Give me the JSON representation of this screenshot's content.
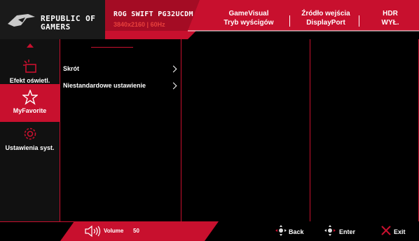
{
  "header": {
    "brand_line1": "REPUBLIC OF",
    "brand_line2": "GAMERS",
    "model": "ROG SWIFT PG32UCDM",
    "resolution": "3840x2160 |",
    "refresh": "60Hz",
    "status": [
      {
        "title": "GameVisual",
        "value": "Tryb wyścigów"
      },
      {
        "title": "Źródło wejścia",
        "value": "DisplayPort"
      },
      {
        "title": "HDR",
        "value": "WYŁ."
      }
    ]
  },
  "sidebar": {
    "items": [
      {
        "label": "Efekt oświetl.",
        "icon": "light-effect-icon"
      },
      {
        "label": "MyFavorite",
        "icon": "star-icon"
      },
      {
        "label": "Ustawienia syst.",
        "icon": "gear-icon"
      }
    ]
  },
  "menu": {
    "items": [
      {
        "label": "Skrót"
      },
      {
        "label": "Niestandardowe ustawienie"
      }
    ]
  },
  "footer": {
    "volume_label": "Volume",
    "volume_value": "50",
    "back_label": "Back",
    "enter_label": "Enter",
    "exit_label": "Exit"
  },
  "colors": {
    "accent": "#c8102e",
    "active_bg": "#c8102e",
    "resolution_text": "#e8403c"
  }
}
